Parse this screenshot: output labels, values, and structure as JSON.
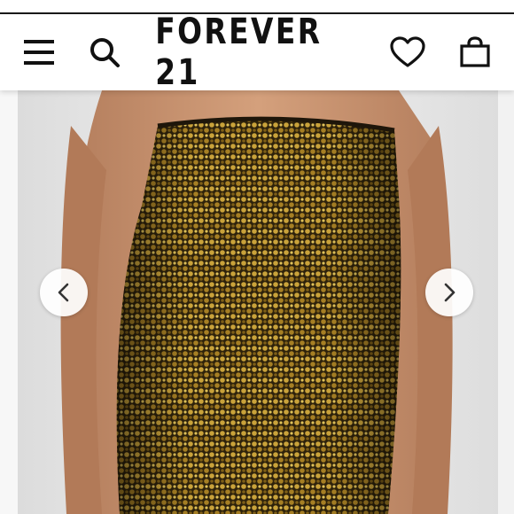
{
  "header": {
    "brand": "FOREVER 21",
    "icons": [
      "menu-icon",
      "search-icon",
      "heart-icon",
      "bag-icon"
    ]
  },
  "product_image": {
    "subject": "",
    "colors": {
      "background": "#e8e8e8",
      "sequin_dark": "#3a2a0c",
      "sequin_gold": "#c9a23a",
      "skin": "#c9906b"
    }
  },
  "carousel": {
    "prev_icon": "chevron-left-icon",
    "next_icon": "chevron-right-icon"
  }
}
